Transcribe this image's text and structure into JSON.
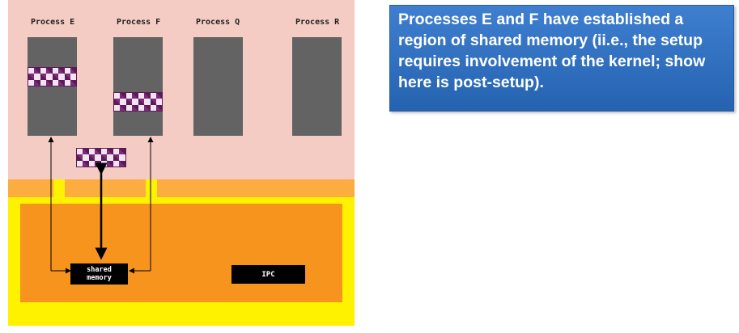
{
  "processes": [
    {
      "label": "Process E"
    },
    {
      "label": "Process F"
    },
    {
      "label": "Process Q"
    },
    {
      "label": "Process R"
    }
  ],
  "kernel": {
    "shared_memory_line1": "shared",
    "shared_memory_line2": "memory",
    "ipc_label": "IPC"
  },
  "callout": {
    "text": "Processes E and F have established a region of shared memory (ii.e., the setup requires involvement of the kernel; show here is post-setup)."
  },
  "colors": {
    "user_space": "#f4ccc3",
    "kernel_outer": "#fff200",
    "kernel_inner": "#f7941e",
    "process_block": "#636363",
    "callout_bg": "#3a78c8"
  }
}
